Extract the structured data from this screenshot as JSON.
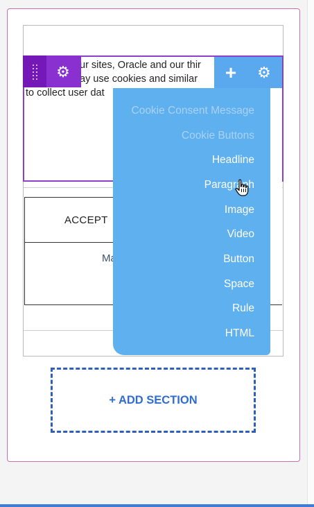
{
  "text_block": {
    "line1": "ur sites, Oracle and our thir",
    "line2": "ay use cookies and similar",
    "line3": "to collect user dat"
  },
  "consent": {
    "accept_label": "ACCEPT",
    "manage_label": "Ma"
  },
  "dropdown": {
    "items": [
      {
        "label": "Cookie Consent Message",
        "state": "disabled"
      },
      {
        "label": "Cookie Buttons",
        "state": "disabled"
      },
      {
        "label": "Headline",
        "state": "enabled"
      },
      {
        "label": "Paragraph",
        "state": "hovered"
      },
      {
        "label": "Image",
        "state": "enabled"
      },
      {
        "label": "Video",
        "state": "enabled"
      },
      {
        "label": "Button",
        "state": "enabled"
      },
      {
        "label": "Space",
        "state": "enabled"
      },
      {
        "label": "Rule",
        "state": "enabled"
      },
      {
        "label": "HTML",
        "state": "enabled"
      }
    ]
  },
  "add_section": {
    "label": "+ ADD SECTION"
  },
  "icons": {
    "drag": "drag-handle-icon",
    "settings": "gear-icon",
    "add": "plus-icon",
    "cursor": "hand-pointer-icon"
  },
  "colors": {
    "selection_purple": "#8a2fd0",
    "toolbar_blue": "#5aa9ef",
    "dropdown_blue": "#5fb0ee",
    "add_section_blue": "#2f6cd0"
  }
}
